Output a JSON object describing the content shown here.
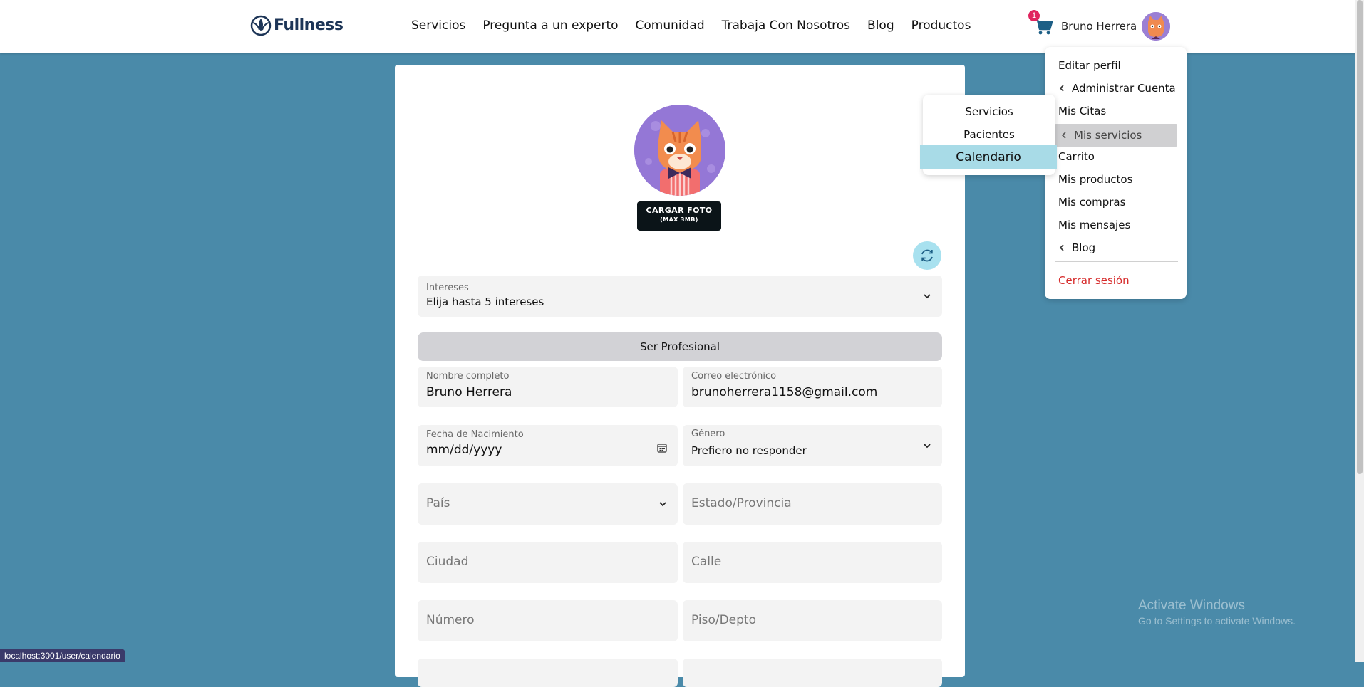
{
  "header": {
    "logo_text": "Fullness",
    "nav": [
      "Servicios",
      "Pregunta a un experto",
      "Comunidad",
      "Trabaja Con Nosotros",
      "Blog",
      "Productos"
    ],
    "cart_count": "1",
    "user_name": "Bruno Herrera"
  },
  "profile": {
    "upload_label": "CARGAR FOTO",
    "upload_hint": "(MAX 3MB)",
    "interests": {
      "label": "Intereses",
      "value": "Elija hasta 5 intereses"
    },
    "pro_button": "Ser Profesional",
    "full_name": {
      "label": "Nombre completo",
      "value": "Bruno Herrera"
    },
    "email": {
      "label": "Correo electrónico",
      "value": "brunoherrera1158@gmail.com"
    },
    "birthdate": {
      "label": "Fecha de Nacimiento",
      "value": "mm/dd/yyyy"
    },
    "gender": {
      "label": "Género",
      "value": "Prefiero no responder"
    },
    "country_placeholder": "País",
    "state_placeholder": "Estado/Provincia",
    "city_placeholder": "Ciudad",
    "street_placeholder": "Calle",
    "number_placeholder": "Número",
    "floor_placeholder": "Piso/Depto"
  },
  "user_menu": {
    "items": [
      "Editar perfil",
      "Administrar Cuenta",
      "Mis Citas",
      "Mis servicios",
      "Carrito",
      "Mis productos",
      "Mis compras",
      "Mis mensajes",
      "Blog"
    ],
    "logout": "Cerrar sesión"
  },
  "submenu": {
    "items": [
      "Servicios",
      "Pacientes",
      "Calendario"
    ]
  },
  "status_url": "localhost:3001/user/calendario",
  "watermark": {
    "title": "Activate Windows",
    "subtitle": "Go to Settings to activate Windows."
  },
  "colors": {
    "accent": "#a8dbe7",
    "background": "#4a8aa9",
    "logout": "#d62b2b",
    "badge": "#e0245e"
  }
}
